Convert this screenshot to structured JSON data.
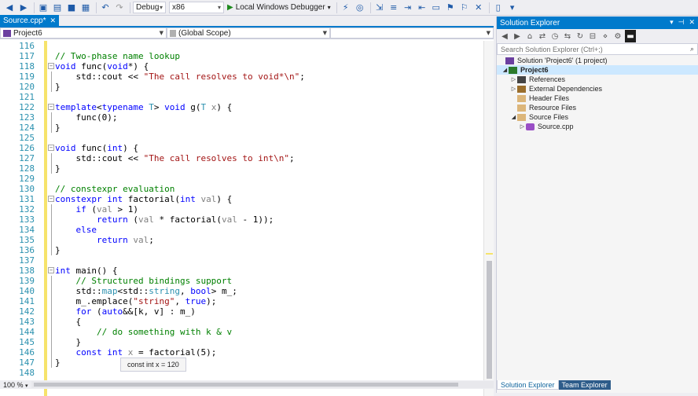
{
  "toolbar": {
    "config": "Debug",
    "platform": "x86",
    "run_label": "Local Windows Debugger"
  },
  "editor": {
    "tab_title": "Source.cpp*",
    "nav_project": "Project6",
    "nav_scope": "(Global Scope)",
    "zoom": "100 %",
    "tooltip": "const int x = 120",
    "lines": [
      {
        "n": "116",
        "t": ""
      },
      {
        "n": "117",
        "t": "// Two-phase name lookup"
      },
      {
        "n": "118",
        "t": "void func(void*) {"
      },
      {
        "n": "119",
        "t": "    std::cout << \"The call resolves to void*\\n\";"
      },
      {
        "n": "120",
        "t": "}"
      },
      {
        "n": "121",
        "t": ""
      },
      {
        "n": "122",
        "t": "template<typename T> void g(T x) {"
      },
      {
        "n": "123",
        "t": "    func(0);"
      },
      {
        "n": "124",
        "t": "}"
      },
      {
        "n": "125",
        "t": ""
      },
      {
        "n": "126",
        "t": "void func(int) {"
      },
      {
        "n": "127",
        "t": "    std::cout << \"The call resolves to int\\n\";"
      },
      {
        "n": "128",
        "t": "}"
      },
      {
        "n": "129",
        "t": ""
      },
      {
        "n": "130",
        "t": "// constexpr evaluation"
      },
      {
        "n": "131",
        "t": "constexpr int factorial(int val) {"
      },
      {
        "n": "132",
        "t": "    if (val > 1)"
      },
      {
        "n": "133",
        "t": "        return (val * factorial(val - 1));"
      },
      {
        "n": "134",
        "t": "    else"
      },
      {
        "n": "135",
        "t": "        return val;"
      },
      {
        "n": "136",
        "t": "}"
      },
      {
        "n": "137",
        "t": ""
      },
      {
        "n": "138",
        "t": "int main() {"
      },
      {
        "n": "139",
        "t": "    // Structured bindings support"
      },
      {
        "n": "140",
        "t": "    std::map<std::string, bool> m_;"
      },
      {
        "n": "141",
        "t": "    m_.emplace(\"string\", true);"
      },
      {
        "n": "142",
        "t": "    for (auto&&[k, v] : m_)"
      },
      {
        "n": "143",
        "t": "    {"
      },
      {
        "n": "144",
        "t": "        // do something with k & v"
      },
      {
        "n": "145",
        "t": "    }"
      },
      {
        "n": "146",
        "t": "    const int x = factorial(5);"
      },
      {
        "n": "147",
        "t": "}"
      },
      {
        "n": "148",
        "t": ""
      }
    ]
  },
  "solution_explorer": {
    "title": "Solution Explorer",
    "search_placeholder": "Search Solution Explorer (Ctrl+;)",
    "items": [
      {
        "label": "Solution 'Project6' (1 project)"
      },
      {
        "label": "Project6"
      },
      {
        "label": "References"
      },
      {
        "label": "External Dependencies"
      },
      {
        "label": "Header Files"
      },
      {
        "label": "Resource Files"
      },
      {
        "label": "Source Files"
      },
      {
        "label": "Source.cpp"
      }
    ],
    "tab_active": "Solution Explorer",
    "tab_other": "Team Explorer"
  },
  "colors": {
    "accent": "#007ACC",
    "keyword": "#0000FF",
    "type": "#2B91AF",
    "string": "#A31515",
    "comment": "#008000"
  }
}
